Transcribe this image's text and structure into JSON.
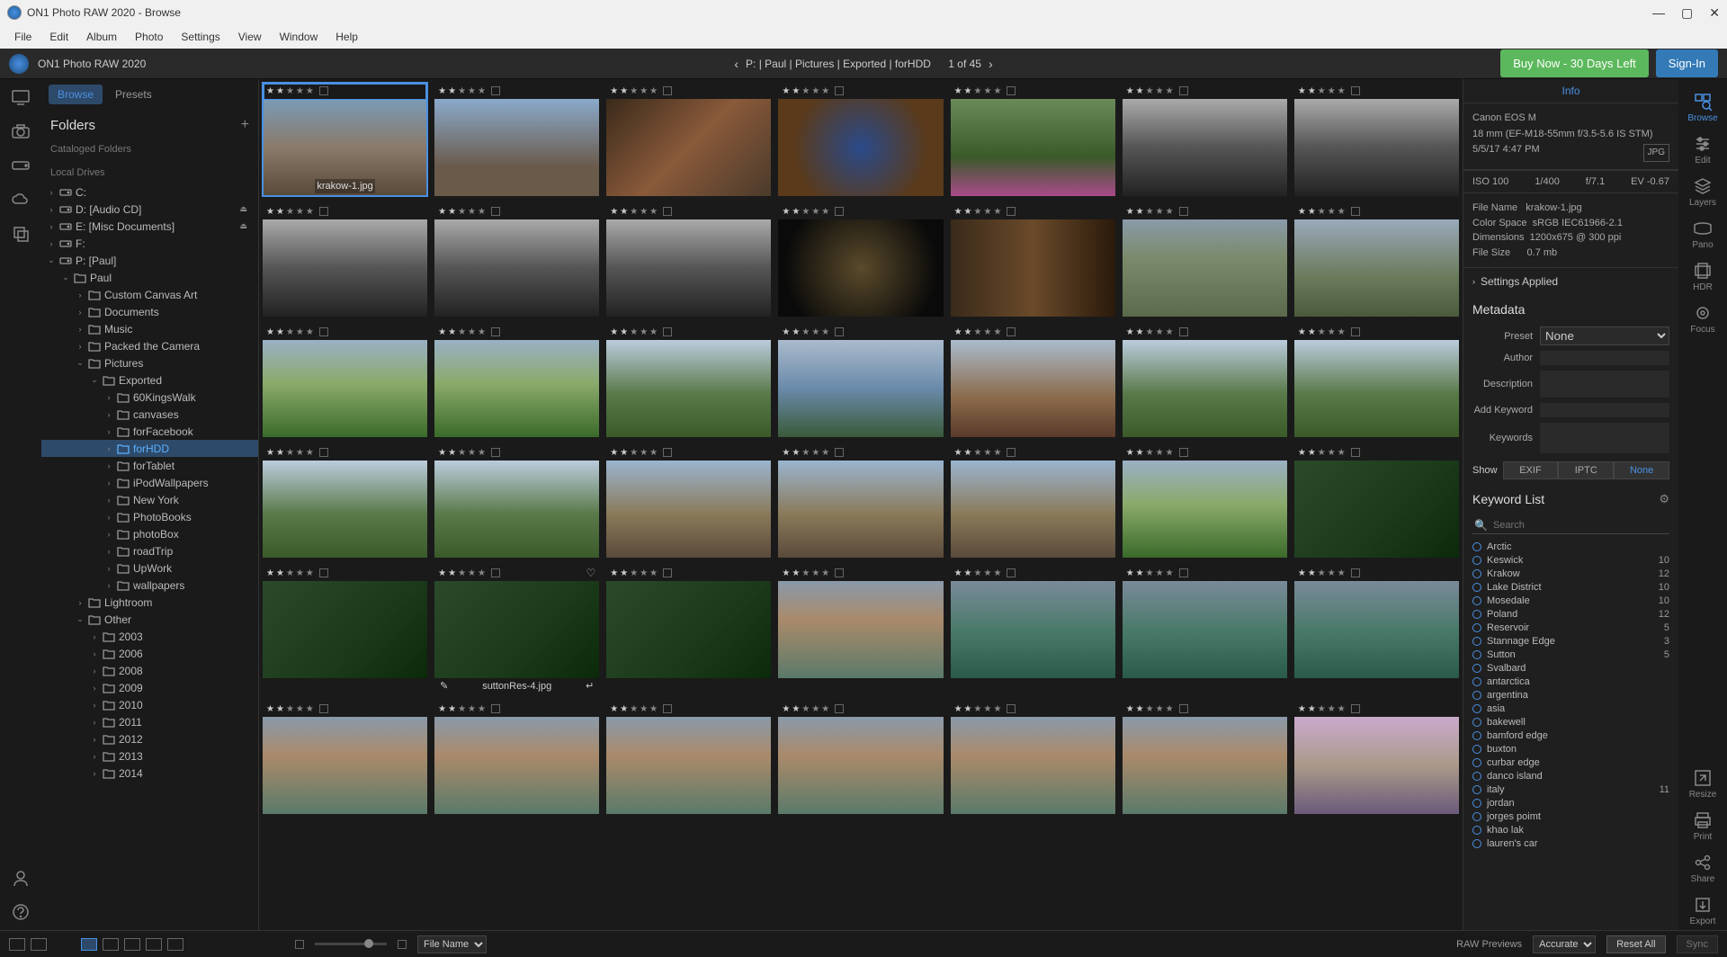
{
  "window_title": "ON1 Photo RAW 2020 - Browse",
  "menu": [
    "File",
    "Edit",
    "Album",
    "Photo",
    "Settings",
    "View",
    "Window",
    "Help"
  ],
  "app_name": "ON1 Photo RAW 2020",
  "breadcrumb": "P: | Paul | Pictures | Exported | forHDD",
  "breadcrumb_count": "1 of 45",
  "buy_button": "Buy Now - 30 Days Left",
  "signin_button": "Sign-In",
  "tabs": {
    "browse": "Browse",
    "presets": "Presets"
  },
  "folders_title": "Folders",
  "cataloged_label": "Cataloged Folders",
  "local_label": "Local Drives",
  "drives": [
    {
      "label": "C:"
    },
    {
      "label": "D: [Audio CD]",
      "eject": true
    },
    {
      "label": "E: [Misc Documents]",
      "eject": true
    },
    {
      "label": "F:"
    }
  ],
  "tree": {
    "p_drive": "P: [Paul]",
    "paul": "Paul",
    "paul_children": [
      "Custom Canvas Art",
      "Documents",
      "Music",
      "Packed the Camera"
    ],
    "pictures": "Pictures",
    "exported": "Exported",
    "exported_children": [
      "60KingsWalk",
      "canvases",
      "forFacebook",
      "forHDD",
      "forTablet",
      "iPodWallpapers",
      "New York",
      "PhotoBooks",
      "photoBox",
      "roadTrip",
      "UpWork",
      "wallpapers"
    ],
    "lightroom": "Lightroom",
    "other": "Other",
    "years": [
      "2003",
      "2006",
      "2008",
      "2009",
      "2010",
      "2011",
      "2012",
      "2013",
      "2014"
    ]
  },
  "thumbs": [
    [
      {
        "r": 2,
        "sel": true,
        "name": "krakow-1.jpg",
        "g": "g-city"
      },
      {
        "r": 2,
        "g": "g-tower"
      },
      {
        "r": 2,
        "g": "g-arch"
      },
      {
        "r": 2,
        "g": "g-ceil"
      },
      {
        "r": 2,
        "g": "g-garden"
      },
      {
        "r": 2,
        "g": "g-bw"
      },
      {
        "r": 2,
        "g": "g-bw"
      }
    ],
    [
      {
        "r": 2,
        "g": "g-bw"
      },
      {
        "r": 2,
        "g": "g-bw"
      },
      {
        "r": 2,
        "g": "g-bw"
      },
      {
        "r": 2,
        "g": "g-dark"
      },
      {
        "r": 2,
        "g": "g-relief"
      },
      {
        "r": 2,
        "g": "g-street"
      },
      {
        "r": 2,
        "g": "g-cabin"
      }
    ],
    [
      {
        "r": 2,
        "g": "g-field"
      },
      {
        "r": 2,
        "g": "g-field"
      },
      {
        "r": 2,
        "g": "g-hills"
      },
      {
        "r": 2,
        "g": "g-lake"
      },
      {
        "r": 2,
        "g": "g-boats"
      },
      {
        "r": 2,
        "g": "g-hills"
      },
      {
        "r": 2,
        "g": "g-hills"
      }
    ],
    [
      {
        "r": 2,
        "g": "g-hills"
      },
      {
        "r": 2,
        "g": "g-hills"
      },
      {
        "r": 2,
        "g": "g-rocks"
      },
      {
        "r": 2,
        "g": "g-rocks"
      },
      {
        "r": 2,
        "g": "g-rocks"
      },
      {
        "r": 2,
        "g": "g-field"
      },
      {
        "r": 2,
        "g": "g-forest"
      }
    ],
    [
      {
        "r": 2,
        "g": "g-forest"
      },
      {
        "r": 2,
        "g": "g-forest",
        "heart": true,
        "name": "suttonRes-4.jpg"
      },
      {
        "r": 2,
        "g": "g-forest"
      },
      {
        "r": 2,
        "g": "g-venice"
      },
      {
        "r": 2,
        "g": "g-canal"
      },
      {
        "r": 2,
        "g": "g-canal"
      },
      {
        "r": 2,
        "g": "g-canal"
      }
    ],
    [
      {
        "r": 2,
        "g": "g-venice"
      },
      {
        "r": 2,
        "g": "g-venice"
      },
      {
        "r": 2,
        "g": "g-venice"
      },
      {
        "r": 2,
        "g": "g-venice"
      },
      {
        "r": 2,
        "g": "g-venice"
      },
      {
        "r": 2,
        "g": "g-venice"
      },
      {
        "r": 2,
        "g": "g-sunset"
      }
    ]
  ],
  "info": {
    "tab": "Info",
    "camera": "Canon EOS M",
    "lens": "18 mm (EF-M18-55mm f/3.5-5.6 IS STM)",
    "date": "5/5/17 4:47 PM",
    "format": "JPG",
    "iso": "ISO 100",
    "shutter": "1/400",
    "aperture": "f/7.1",
    "ev": "EV -0.67",
    "filename_l": "File Name",
    "filename": "krakow-1.jpg",
    "cs_l": "Color Space",
    "cs": "sRGB IEC61966-2.1",
    "dim_l": "Dimensions",
    "dim": "1200x675 @ 300 ppi",
    "size_l": "File Size",
    "size": "0.7 mb",
    "settings": "Settings Applied"
  },
  "meta": {
    "title": "Metadata",
    "preset_l": "Preset",
    "preset_v": "None",
    "author_l": "Author",
    "desc_l": "Description",
    "addkw_l": "Add Keyword",
    "kw_l": "Keywords",
    "show": "Show",
    "exif": "EXIF",
    "iptc": "IPTC",
    "none": "None"
  },
  "kwlist": {
    "title": "Keyword List",
    "search_ph": "Search",
    "items": [
      {
        "n": "Arctic"
      },
      {
        "n": "Keswick",
        "c": "10"
      },
      {
        "n": "Krakow",
        "c": "12"
      },
      {
        "n": "Lake District",
        "c": "10"
      },
      {
        "n": "Mosedale",
        "c": "10"
      },
      {
        "n": "Poland",
        "c": "12"
      },
      {
        "n": "Reservoir",
        "c": "5"
      },
      {
        "n": "Stannage Edge",
        "c": "3"
      },
      {
        "n": "Sutton",
        "c": "5"
      },
      {
        "n": "Svalbard"
      },
      {
        "n": "antarctica"
      },
      {
        "n": "argentina"
      },
      {
        "n": "asia"
      },
      {
        "n": "bakewell"
      },
      {
        "n": "bamford edge"
      },
      {
        "n": "buxton"
      },
      {
        "n": "curbar edge"
      },
      {
        "n": "danco island"
      },
      {
        "n": "italy",
        "c": "11"
      },
      {
        "n": "jordan"
      },
      {
        "n": "jorges poimt"
      },
      {
        "n": "khao lak"
      },
      {
        "n": "lauren's car"
      }
    ]
  },
  "right_tools": [
    "Browse",
    "Edit",
    "Layers",
    "Pano",
    "HDR",
    "Focus",
    "Resize",
    "Print",
    "Share",
    "Export"
  ],
  "bottom": {
    "filename": "File Name",
    "raw_prev": "RAW Previews",
    "accurate": "Accurate",
    "reset": "Reset All",
    "sync": "Sync"
  }
}
